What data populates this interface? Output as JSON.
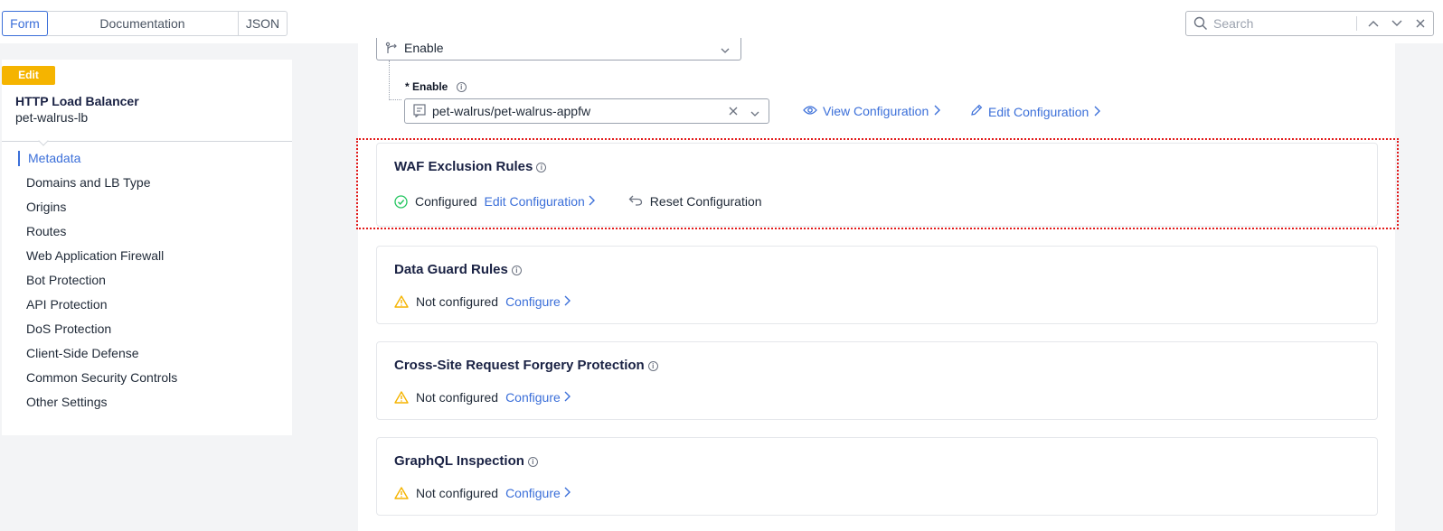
{
  "topbar": {
    "tabs": [
      {
        "label": "Form",
        "active": true
      },
      {
        "label": "Documentation",
        "active": false
      },
      {
        "label": "JSON",
        "active": false
      }
    ],
    "search": {
      "placeholder": "Search"
    }
  },
  "sidebar": {
    "badge": "Edit",
    "object_type": "HTTP Load Balancer",
    "object_name": "pet-walrus-lb",
    "items": [
      {
        "label": "Metadata",
        "active": true
      },
      {
        "label": "Domains and LB Type"
      },
      {
        "label": "Origins"
      },
      {
        "label": "Routes"
      },
      {
        "label": "Web Application Firewall"
      },
      {
        "label": "Bot Protection"
      },
      {
        "label": "API Protection"
      },
      {
        "label": "DoS Protection"
      },
      {
        "label": "Client-Side Defense"
      },
      {
        "label": "Common Security Controls"
      },
      {
        "label": "Other Settings"
      }
    ]
  },
  "main": {
    "waf_select": {
      "value": "Enable"
    },
    "enable_field": {
      "label": "* Enable",
      "value": "pet-walrus/pet-walrus-appfw"
    },
    "view_config_label": "View Configuration",
    "edit_config_label": "Edit Configuration",
    "sections": [
      {
        "title": "WAF Exclusion Rules",
        "status": "Configured",
        "action": "Edit Configuration",
        "reset": "Reset Configuration"
      },
      {
        "title": "Data Guard Rules",
        "status": "Not configured",
        "action": "Configure"
      },
      {
        "title": "Cross-Site Request Forgery Protection",
        "status": "Not configured",
        "action": "Configure"
      },
      {
        "title": "GraphQL Inspection",
        "status": "Not configured",
        "action": "Configure"
      }
    ]
  },
  "colors": {
    "accent": "#3b6fd9",
    "badge": "#f5b400",
    "ok": "#22c55e",
    "warn": "#f5b400",
    "highlight": "#e31b1b"
  }
}
